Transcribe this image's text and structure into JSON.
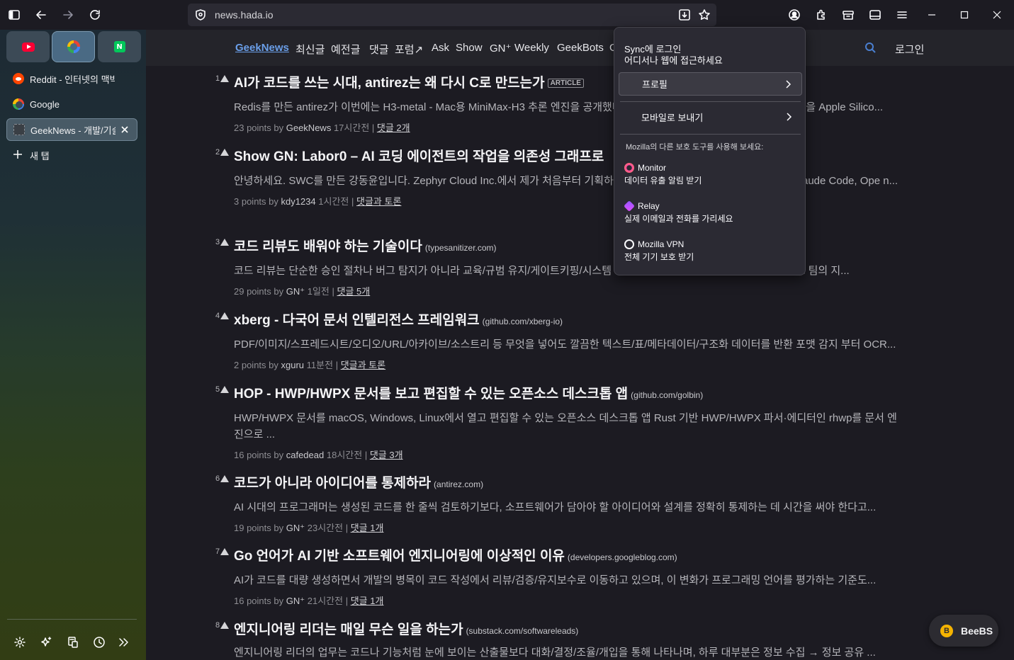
{
  "toolbar": {
    "url": "news.hada.io"
  },
  "sidebar": {
    "pinned": [
      {
        "name": "youtube"
      },
      {
        "name": "google"
      },
      {
        "name": "naver"
      }
    ],
    "tabs": [
      {
        "label": "Reddit - 인터넷의 맥박"
      },
      {
        "label": "Google"
      },
      {
        "label": "GeekNews - 개발/기술/스타트업 뉴스"
      }
    ],
    "new_tab_label": "새 탭"
  },
  "site": {
    "nav": {
      "logo": "GeekNews",
      "items": [
        "최신글",
        "예전글",
        "댓글",
        "포럼↗",
        "Ask",
        "Show",
        "GN⁺",
        "Weekly",
        "GeekBots",
        "G"
      ],
      "login": "로그인"
    },
    "items": [
      {
        "num": "1",
        "title": "AI가 코드를 쓰는 시대, antirez는 왜 다시 C로 만드는가",
        "domain": "",
        "tag": "ARTICLE",
        "desc": "Redis를 만든 antirez가 이번에는 H3-metal - Mac용 MiniMax-H3 추론 엔진을 공개했다. 공개 추론 파이프라인으로 돌아가는 모델을 Apple Silico...",
        "points": "23 points by",
        "author": "GeekNews",
        "time": "17시간전",
        "comments": "댓글 2개"
      },
      {
        "num": "2",
        "title": "Show GN: Labor0 – AI 코딩 에이전트의 작업을 의존성 그래프로",
        "domain": "",
        "tag": "",
        "desc": "안녕하세요. SWC를 만든 강동윤입니다. Zephyr Cloud Inc.에서 제가 처음부터 기획하고 만든 오픈소스를 소개합니다. Codex, Claude Code, Ope n...",
        "points": "3 points by",
        "author": "kdy1234",
        "time": "1시간전",
        "comments": "댓글과 토론"
      },
      {
        "num": "3",
        "title": "코드 리뷰도 배워야 하는 기술이다",
        "domain": "(typesanitizer.com)",
        "tag": "",
        "desc": "코드 리뷰는 단순한 승인 절차나 버그 탐지가 아니라 교육/규범 유지/게이트키핑/시스템 이해를 포함하는 활동이며, 코드를 이해하고 팀의 지...",
        "points": "29 points by",
        "author": "GN⁺",
        "time": "1일전",
        "comments": "댓글 5개"
      },
      {
        "num": "4",
        "title": "xberg - 다국어 문서 인텔리전스 프레임워크",
        "domain": "(github.com/xberg-io)",
        "tag": "",
        "desc": "PDF/이미지/스프레드시트/오디오/URL/아카이브/소스트리 등 무엇을 넣어도 깔끔한 텍스트/표/메타데이터/구조화 데이터를 반환 포맷 감지 부터 OCR...",
        "points": "2 points by",
        "author": "xguru",
        "time": "11분전",
        "comments": "댓글과 토론"
      },
      {
        "num": "5",
        "title": "HOP - HWP/HWPX 문서를 보고 편집할 수 있는 오픈소스 데스크톱 앱",
        "domain": "(github.com/golbin)",
        "tag": "",
        "desc": "HWP/HWPX 문서를 macOS, Windows, Linux에서 열고 편집할 수 있는 오픈소스 데스크톱 앱 Rust 기반 HWP/HWPX 파서·에디터인 rhwp를 문서 엔진으로 ...",
        "points": "16 points by",
        "author": "cafedead",
        "time": "18시간전",
        "comments": "댓글 3개"
      },
      {
        "num": "6",
        "title": "코드가 아니라 아이디어를 통제하라",
        "domain": "(antirez.com)",
        "tag": "",
        "desc": "AI 시대의 프로그래머는 생성된 코드를 한 줄씩 검토하기보다, 소프트웨어가 담아야 할 아이디어와 설계를 정확히 통제하는 데 시간을 써야 한다고...",
        "points": "19 points by",
        "author": "GN⁺",
        "time": "23시간전",
        "comments": "댓글 1개"
      },
      {
        "num": "7",
        "title": "Go 언어가 AI 기반 소프트웨어 엔지니어링에 이상적인 이유",
        "domain": "(developers.googleblog.com)",
        "tag": "",
        "desc": "AI가 코드를 대량 생성하면서 개발의 병목이 코드 작성에서 리뷰/검증/유지보수로 이동하고 있으며, 이 변화가 프로그래밍 언어를 평가하는 기준도...",
        "points": "16 points by",
        "author": "GN⁺",
        "time": "21시간전",
        "comments": "댓글 1개"
      },
      {
        "num": "8",
        "title": "엔지니어링 리더는 매일 무슨 일을 하는가",
        "domain": "(substack.com/softwareleads)",
        "tag": "",
        "desc": "엔지니어링 리더의 업무는 코드나 기능처럼 눈에 보이는 산출물보다 대화/결정/조율/개입을 통해 나타나며, 하루 대부분은 정보 수집 → 정보 공유 ...",
        "points": "",
        "author": "",
        "time": "",
        "comments": ""
      }
    ]
  },
  "popup": {
    "sync_title": "Sync에 로그인",
    "sync_sub": "어디서나 웹에 접근하세요",
    "profile": "프로필",
    "send_to_mobile": "모바일로 보내기",
    "tools_heading": "Mozilla의 다른 보호 도구를 사용해 보세요:",
    "tools": [
      {
        "name": "Monitor",
        "desc": "데이터 유출 알림 받기"
      },
      {
        "name": "Relay",
        "desc": "실제 이메일과 전화를 가리세요"
      },
      {
        "name": "Mozilla VPN",
        "desc": "전체 기기 보호 받기"
      }
    ]
  },
  "badge": {
    "label": "BeeBS",
    "icon_letter": "B"
  }
}
